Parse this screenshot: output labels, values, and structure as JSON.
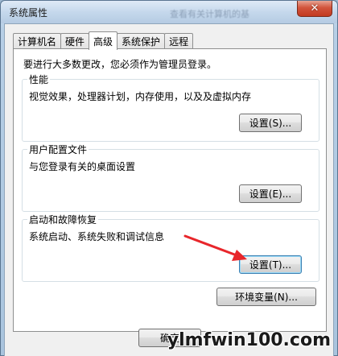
{
  "window": {
    "title": "系统属性",
    "close_glyph": "✕",
    "blurred_bg_text": "查看有关计算机的基"
  },
  "tabs": [
    {
      "label": "计算机名",
      "active": false
    },
    {
      "label": "硬件",
      "active": false
    },
    {
      "label": "高级",
      "active": true
    },
    {
      "label": "系统保护",
      "active": false
    },
    {
      "label": "远程",
      "active": false
    }
  ],
  "advanced": {
    "intro": "要进行大多数更改，您必须作为管理员登录。",
    "performance": {
      "label": "性能",
      "desc": "视觉效果，处理器计划，内存使用，以及及虚拟内存",
      "button": "设置(S)..."
    },
    "profiles": {
      "label": "用户配置文件",
      "desc": "与您登录有关的桌面设置",
      "button": "设置(E)..."
    },
    "startup": {
      "label": "启动和故障恢复",
      "desc": "系统启动、系统失败和调试信息",
      "button": "设置(T)..."
    },
    "env_button": "环境变量(N)..."
  },
  "footer": {
    "ok_button": "确定"
  },
  "watermark": "ylmfwin100.com",
  "colors": {
    "arrow": "#e8262b",
    "close": "#c8432a"
  }
}
